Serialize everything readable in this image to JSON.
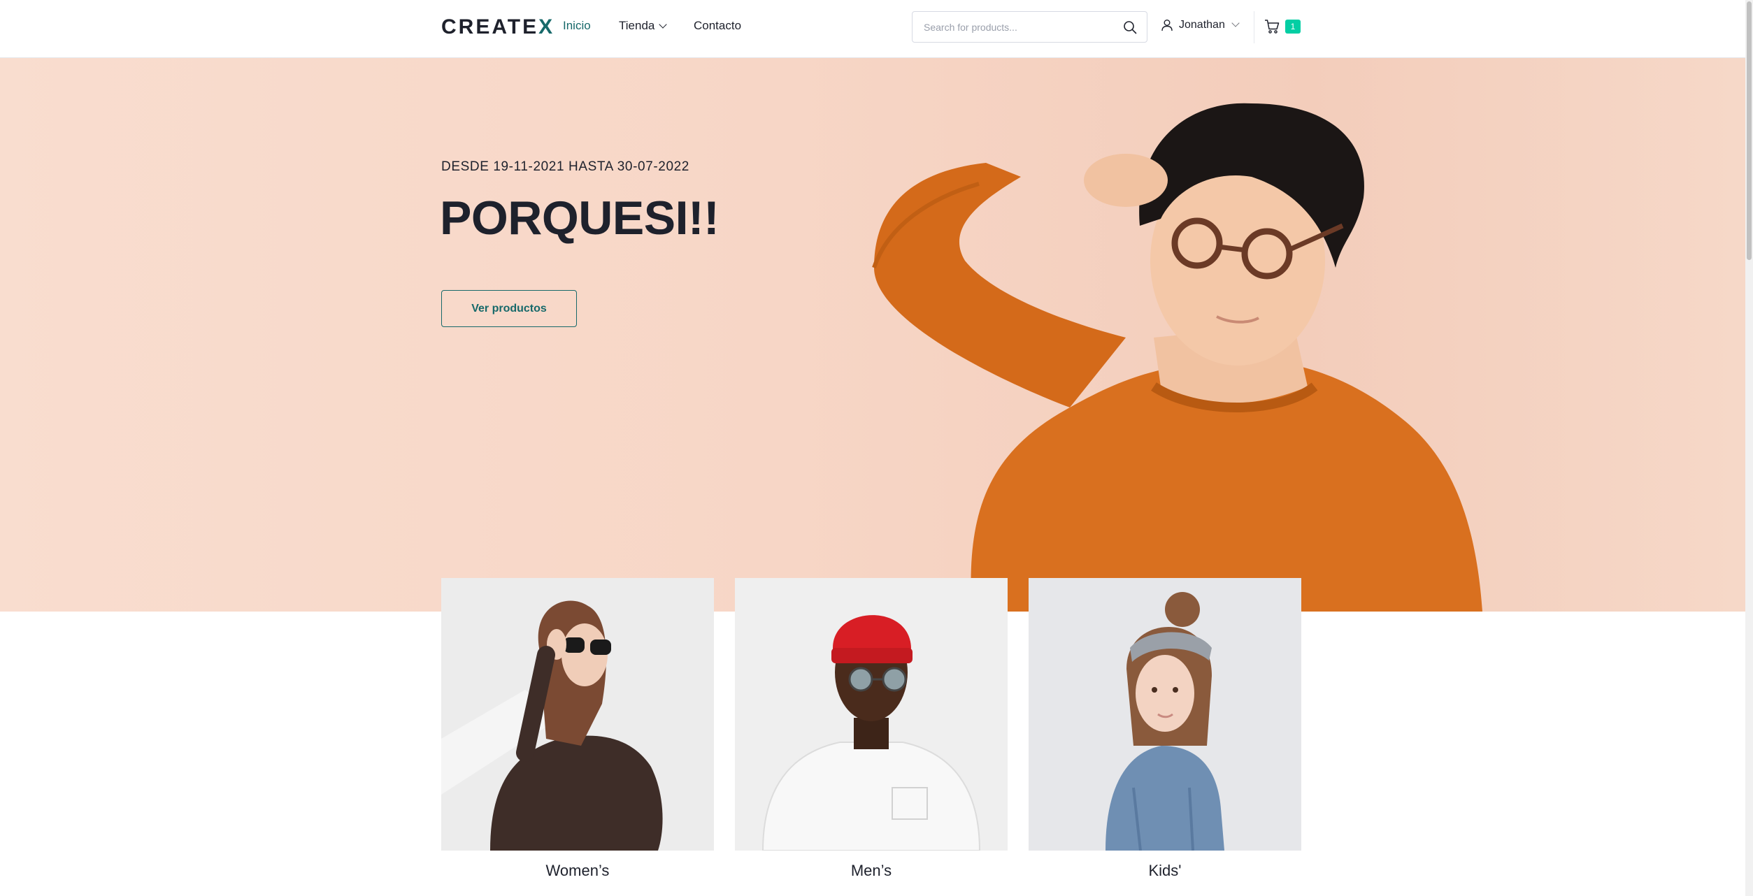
{
  "header": {
    "logo_prefix": "CREATE",
    "logo_accent": "X",
    "nav": {
      "home": "Inicio",
      "shop": "Tienda",
      "contact": "Contacto"
    },
    "search": {
      "placeholder": "Search for products..."
    },
    "user": {
      "name": "Jonathan"
    },
    "cart": {
      "count": "1"
    }
  },
  "hero": {
    "dates": "DESDE 19-11-2021 HASTA 30-07-2022",
    "title": "PORQUESI!!",
    "button": "Ver productos"
  },
  "categories": [
    {
      "label": "Women’s"
    },
    {
      "label": "Men’s"
    },
    {
      "label": "Kids'"
    }
  ],
  "colors": {
    "accent": "#17696a",
    "badge": "#03cea4",
    "text": "#1e212c",
    "hero_bg": "#f7d6c6",
    "sweater": "#d9701f"
  },
  "icons": [
    "search-icon",
    "user-icon",
    "chevron-down-icon",
    "cart-icon"
  ]
}
